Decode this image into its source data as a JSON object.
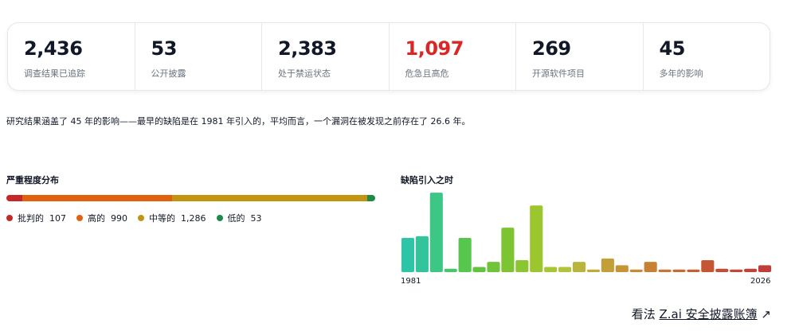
{
  "stats": [
    {
      "value": "2,436",
      "label": "调查结果已追踪",
      "tone": "normal"
    },
    {
      "value": "53",
      "label": "公开披露",
      "tone": "normal"
    },
    {
      "value": "2,383",
      "label": "处于禁运状态",
      "tone": "normal"
    },
    {
      "value": "1,097",
      "label": "危急且高危",
      "tone": "danger"
    },
    {
      "value": "269",
      "label": "开源软件项目",
      "tone": "normal"
    },
    {
      "value": "45",
      "label": "多年的影响",
      "tone": "normal"
    }
  ],
  "summary": "研究结果涵盖了 45 年的影响——最早的缺陷是在 1981 年引入的，平均而言，一个漏洞在被发现之前存在了 26.6 年。",
  "severity": {
    "title": "严重程度分布",
    "items": [
      {
        "label": "批判的",
        "count": "107",
        "value": 107,
        "color": "#c62828"
      },
      {
        "label": "高的",
        "count": "990",
        "value": 990,
        "color": "#e0620f"
      },
      {
        "label": "中等的",
        "count": "1,286",
        "value": 1286,
        "color": "#c39410"
      },
      {
        "label": "低的",
        "count": "53",
        "value": 53,
        "color": "#1d8a4a"
      }
    ]
  },
  "introduced": {
    "title": "缺陷引入之时",
    "start_label": "1981",
    "end_label": "2026"
  },
  "chart_data": {
    "type": "bar",
    "title": "缺陷引入之时",
    "x_range": [
      "1981",
      "2026"
    ],
    "ylim": [
      0,
      95
    ],
    "values": [
      40,
      42,
      93,
      4,
      40,
      6,
      12,
      52,
      14,
      78,
      6,
      6,
      12,
      3,
      16,
      8,
      3,
      12,
      3,
      3,
      3,
      14,
      4,
      3,
      4,
      8
    ],
    "colors": [
      "#2ec4a6",
      "#34c49c",
      "#3cc784",
      "#48c66c",
      "#56c64c",
      "#62c43e",
      "#6fc438",
      "#7cc432",
      "#8ac532",
      "#9cc62e",
      "#a8c633",
      "#b2c23a",
      "#bab43c",
      "#c0aa38",
      "#c49e36",
      "#c69434",
      "#c68c34",
      "#c68232",
      "#c67634",
      "#c66a34",
      "#c46236",
      "#c45634",
      "#c24e36",
      "#c24838",
      "#c2423a",
      "#c23c3a"
    ]
  },
  "ledger_link": {
    "prefix": "看法 ",
    "underlined": "Z.ai 安全披露账簿",
    "arrow": " ↗"
  }
}
